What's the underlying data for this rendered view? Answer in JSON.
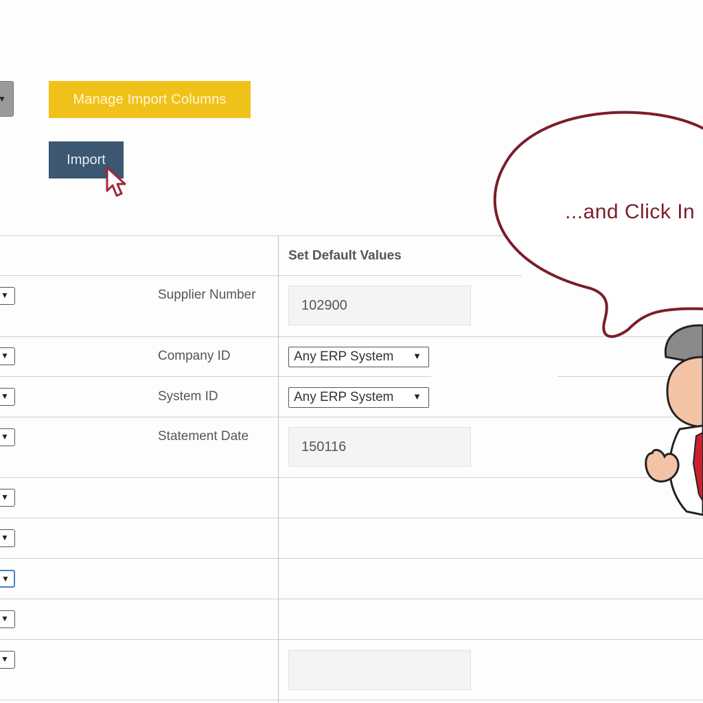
{
  "toolbar": {
    "manage_columns_label": "Manage Import Columns",
    "import_label": "Import",
    "select_arrow": "▼"
  },
  "table": {
    "default_values_header": "Set Default Values",
    "rows": [
      {
        "field": "Supplier Number",
        "default_value": "102900"
      },
      {
        "field": "Company ID",
        "default_value": "Any ERP System"
      },
      {
        "field": "System ID",
        "default_value": "Any ERP System"
      },
      {
        "field": "Statement Date",
        "default_value": "150116"
      },
      {
        "field": "",
        "default_value": ""
      },
      {
        "field": "",
        "default_value": ""
      },
      {
        "field": "",
        "default_value": ""
      },
      {
        "field": "",
        "default_value": ""
      },
      {
        "field": "",
        "default_value": ""
      }
    ]
  },
  "callout": {
    "text": "...and Click In"
  },
  "icons": {
    "cursor": "mouse-pointer-icon",
    "mascot": "cartoon-businessman-icon"
  },
  "colors": {
    "manage_button": "#f0c219",
    "import_button": "#3b5772",
    "callout_text": "#7b1d2b"
  }
}
